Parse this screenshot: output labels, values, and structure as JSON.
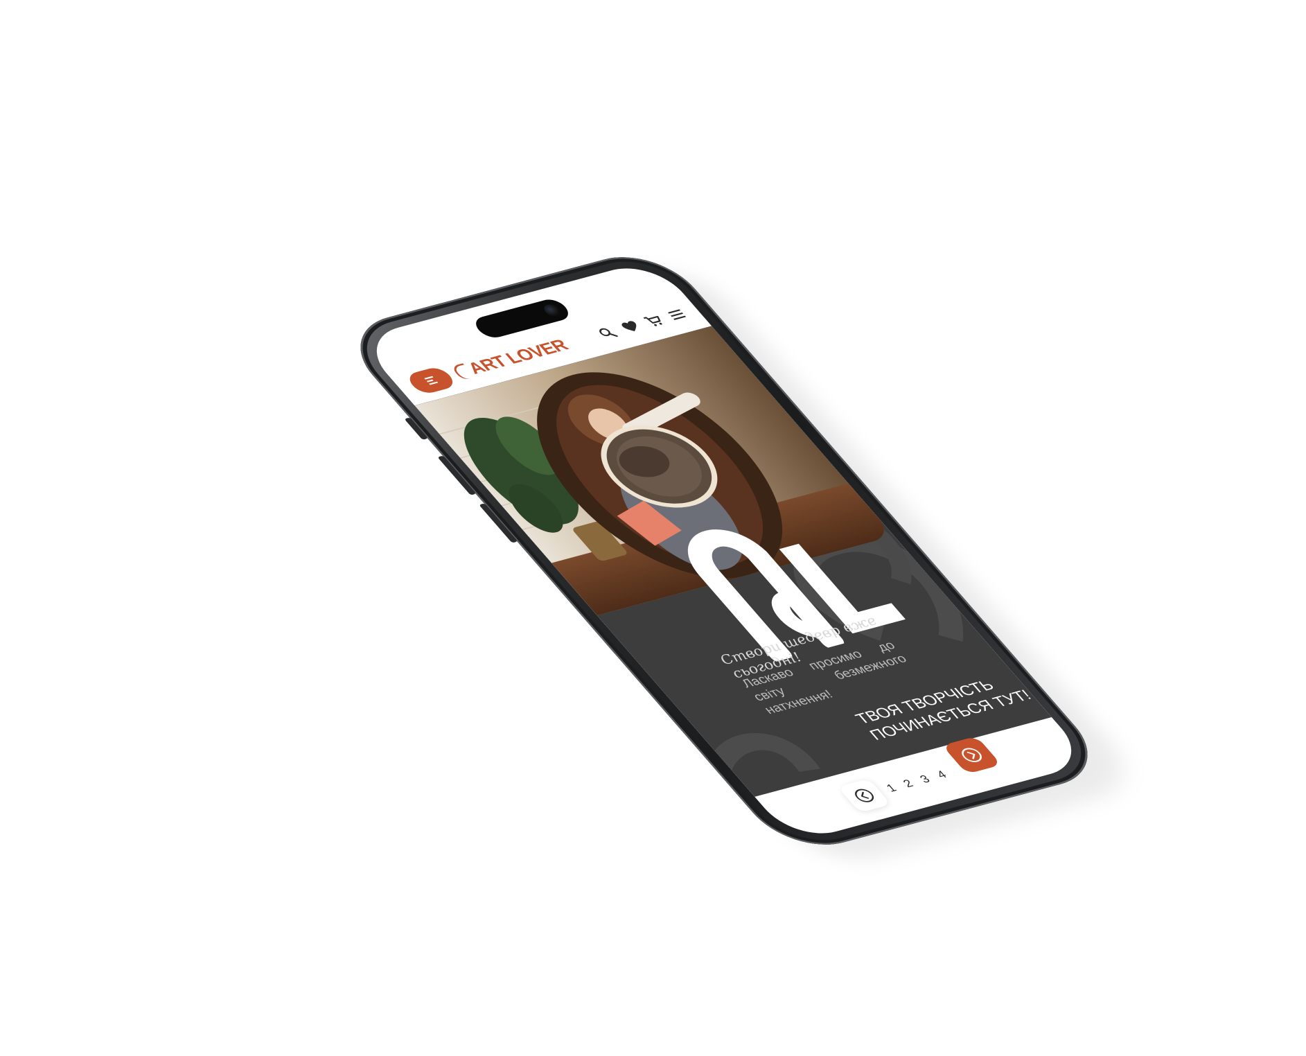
{
  "header": {
    "logo_text": "ART LOVER",
    "icons": [
      "menu-icon",
      "search-icon",
      "heart-icon",
      "cart-icon",
      "hamburger-icon"
    ]
  },
  "hero": {
    "script_text": "Створи шедевр вже сьогодні!",
    "welcome_text": "Ласкаво просимо до світу безмежного натхнення!",
    "tagline": "ТВОЯ ТВОРЧІСТЬ ПОЧИНАЄТЬСЯ ТУТ!"
  },
  "pagination": {
    "pages": [
      "1",
      "2",
      "3",
      "4"
    ]
  },
  "colors": {
    "accent": "#c8522b",
    "hero_background": "#3d3d3e",
    "screen_background": "#ffffff"
  }
}
